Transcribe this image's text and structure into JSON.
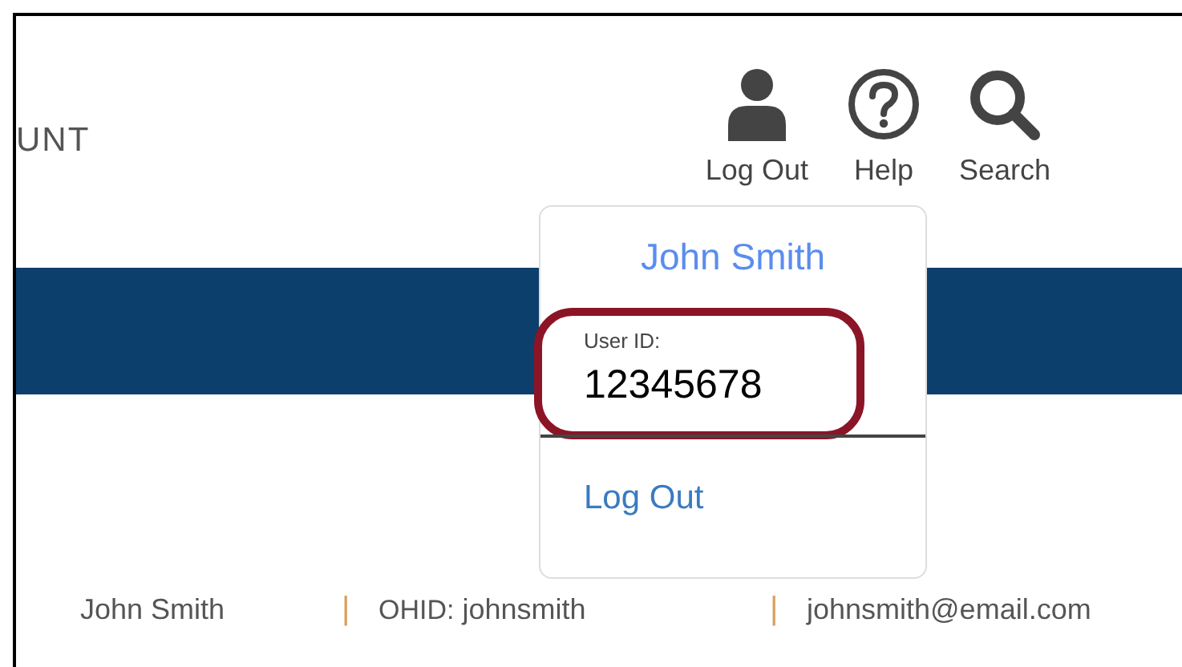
{
  "header": {
    "nav_item": "UNT",
    "actions": [
      {
        "label": "Log Out",
        "kind": "account"
      },
      {
        "label": "Help",
        "kind": "help"
      },
      {
        "label": "Search",
        "kind": "search"
      }
    ]
  },
  "user_menu": {
    "name": "John Smith",
    "user_id_label": "User ID:",
    "user_id": "12345678",
    "highlighted": true,
    "link": "Log Out"
  },
  "profile_bar": {
    "separator": "|",
    "fields": [
      {
        "value": "John Smith"
      },
      {
        "label": "OHID:",
        "value": "johnsmith"
      },
      {
        "value": "johnsmith@email.com"
      }
    ]
  }
}
